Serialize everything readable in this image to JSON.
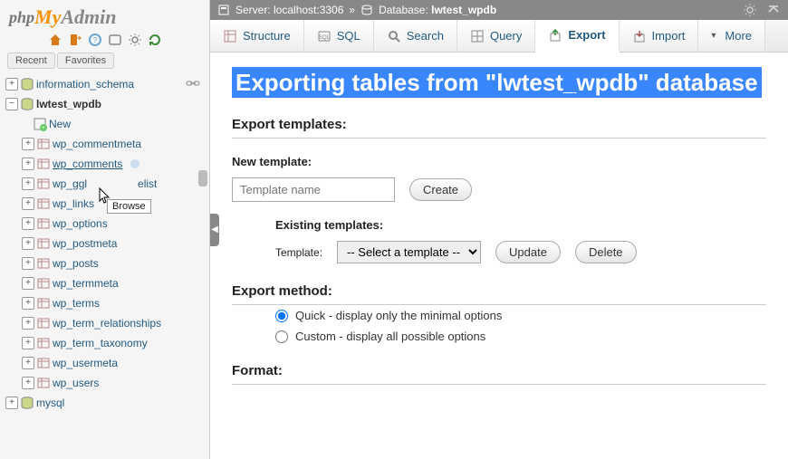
{
  "logo": {
    "php": "php",
    "my": "My",
    "admin": "Admin"
  },
  "sidebar_tabs": {
    "recent": "Recent",
    "favorites": "Favorites"
  },
  "tree": {
    "db1": "information_schema",
    "db2": "lwtest_wpdb",
    "db2_new": "New",
    "tables": [
      "wp_commentmeta",
      "wp_comments",
      "wp_gglcptch_whitelist",
      "wp_links",
      "wp_options",
      "wp_postmeta",
      "wp_posts",
      "wp_termmeta",
      "wp_terms",
      "wp_term_relationships",
      "wp_term_taxonomy",
      "wp_usermeta",
      "wp_users"
    ],
    "table_masked": "wp_ggl",
    "table_masked_suffix": "elist",
    "db3": "mysql"
  },
  "tooltip": "Browse",
  "breadcrumb": {
    "server_label": "Server: ",
    "server_value": "localhost:3306",
    "sep": " » ",
    "db_label": "Database: ",
    "db_value": "lwtest_wpdb"
  },
  "menu": {
    "structure": "Structure",
    "sql": "SQL",
    "search": "Search",
    "query": "Query",
    "export": "Export",
    "import": "Import",
    "more": "More"
  },
  "page": {
    "title": "Exporting tables from \"lwtest_wpdb\" database",
    "export_templates": "Export templates:",
    "new_template": "New template:",
    "template_placeholder": "Template name",
    "create": "Create",
    "existing_templates": "Existing templates:",
    "template_label": "Template:",
    "select_placeholder": "-- Select a template --",
    "update": "Update",
    "delete": "Delete",
    "export_method": "Export method:",
    "quick": "Quick - display only the minimal options",
    "custom": "Custom - display all possible options",
    "format": "Format:"
  }
}
